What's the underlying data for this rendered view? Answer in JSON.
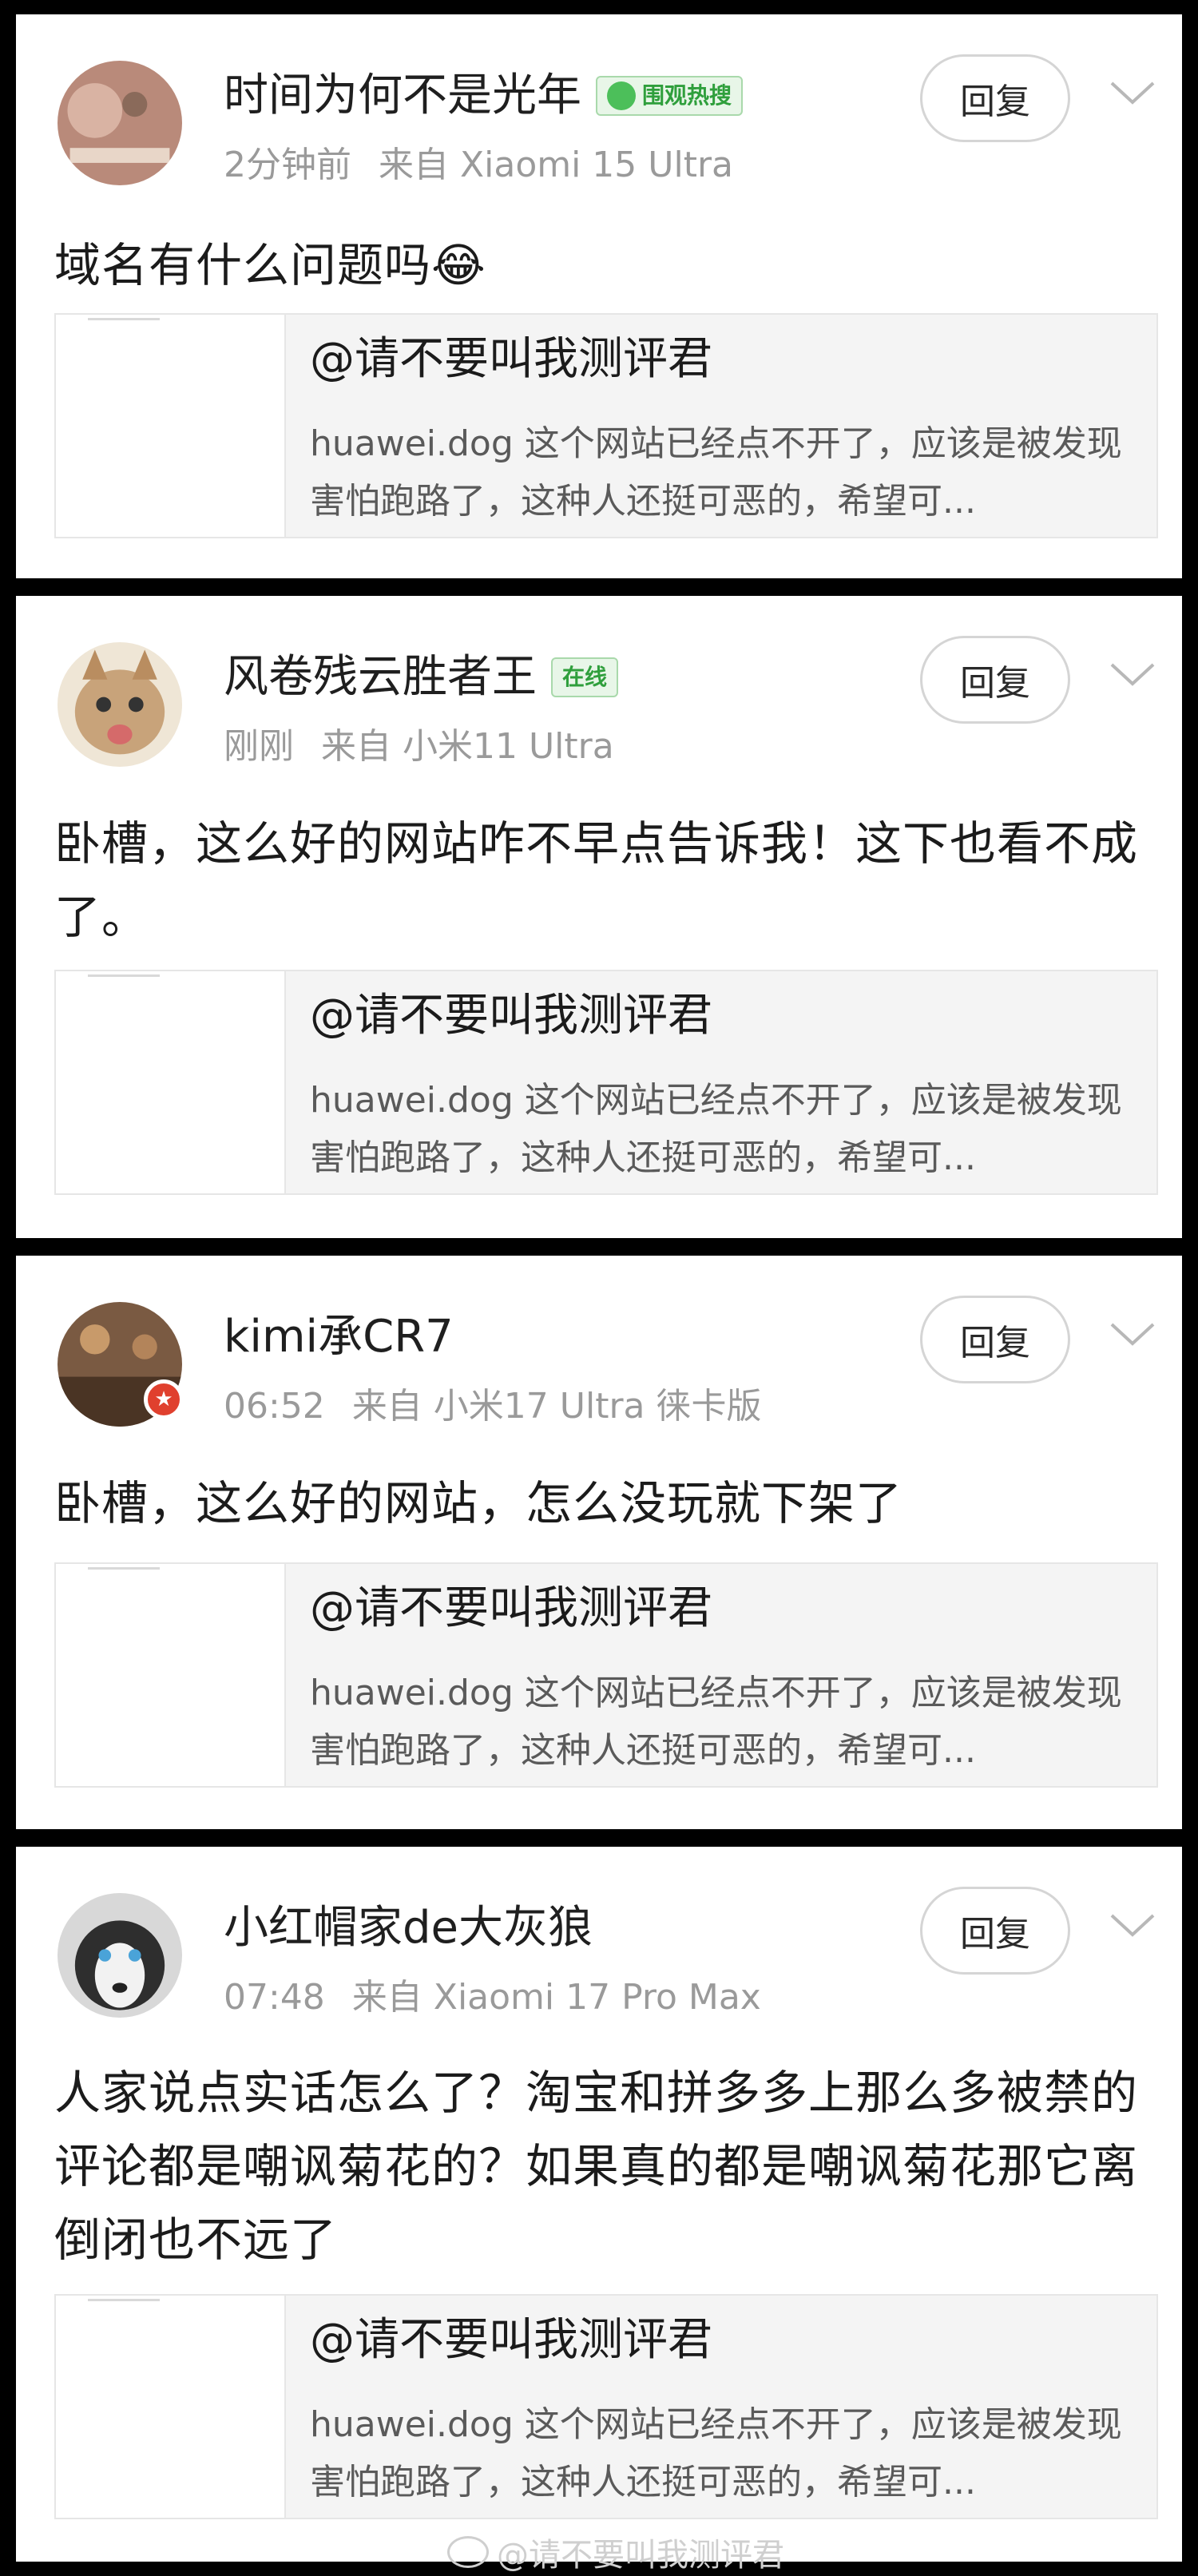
{
  "comments": [
    {
      "username": "时间为何不是光年",
      "tag": "围观热搜",
      "time": "2分钟前",
      "device": "来自 Xiaomi 15 Ultra",
      "reply_label": "回复",
      "text": "域名有什么问题吗😂",
      "quote_author": "@请不要叫我测评君",
      "quote_text": "huawei.dog 这个网站已经点不开了，应该是被发现害怕跑路了，这种人还挺可恶的，希望可..."
    },
    {
      "username": "风卷残云胜者王",
      "tag": "在线",
      "time": "刚刚",
      "device": "来自 小米11 Ultra",
      "reply_label": "回复",
      "text": "卧槽，这么好的网站咋不早点告诉我！这下也看不成了。",
      "quote_author": "@请不要叫我测评君",
      "quote_text": "huawei.dog 这个网站已经点不开了，应该是被发现害怕跑路了，这种人还挺可恶的，希望可..."
    },
    {
      "username": "kimi承CR7",
      "time": "06:52",
      "device": "来自 小米17 Ultra 徕卡版",
      "reply_label": "回复",
      "text": "卧槽，这么好的网站，怎么没玩就下架了",
      "quote_author": "@请不要叫我测评君",
      "quote_text": "huawei.dog 这个网站已经点不开了，应该是被发现害怕跑路了，这种人还挺可恶的，希望可..."
    },
    {
      "username": "小红帽家de大灰狼",
      "time": "07:48",
      "device": "来自 Xiaomi 17 Pro Max",
      "reply_label": "回复",
      "text": "人家说点实话怎么了？淘宝和拼多多上那么多被禁的评论都是嘲讽菊花的？如果真的都是嘲讽菊花那它离倒闭也不远了",
      "quote_author": "@请不要叫我测评君",
      "quote_text": "huawei.dog 这个网站已经点不开了，应该是被发现害怕跑路了，这种人还挺可恶的，希望可..."
    }
  ],
  "watermark": "@请不要叫我测评君",
  "icons": {
    "tag_icon": "smile-icon",
    "menu_icon": "chevron-down-icon",
    "badge_icon": "star-badge-icon",
    "watermark_icon": "weibo-icon"
  },
  "colors": {
    "tag_green": "#2f9f3c",
    "badge_red": "#e0402e"
  }
}
